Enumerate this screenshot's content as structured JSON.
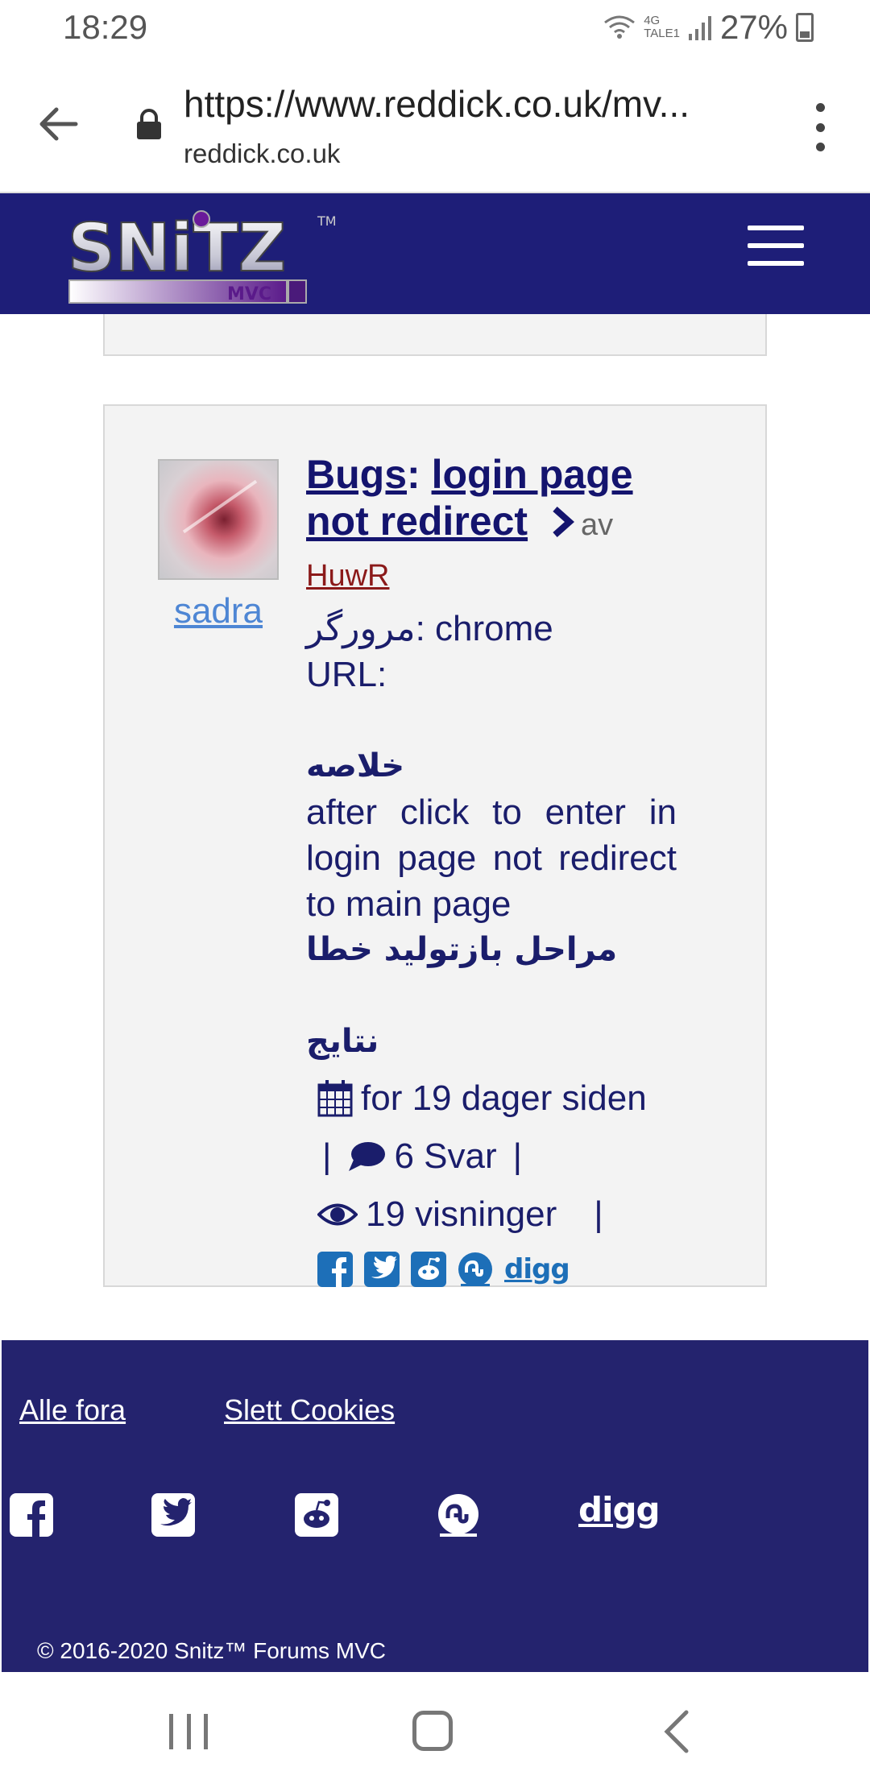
{
  "status_bar": {
    "time": "18:29",
    "network_top": "4G",
    "network_bottom": "TALE1",
    "battery": "27%"
  },
  "browser": {
    "url": "https://www.reddick.co.uk/mv...",
    "host": "reddick.co.uk"
  },
  "site": {
    "logo_text": "SNiTZ",
    "logo_sub": "MVC",
    "logo_tm": "TM"
  },
  "post": {
    "username": "sadra",
    "category": "Bugs",
    "separator": ":",
    "title": "login page not redirect",
    "by_label": "av",
    "author": "HuwR",
    "line_browser": "مرورگر: chrome",
    "line_url": "URL:",
    "summary_heading": "خلاصه",
    "summary_text": "after click to enter in login page not redirect to main page",
    "steps_heading": "مراحل بازتولید خطا",
    "results_heading": "نتایج",
    "date": "for 19 dager siden",
    "replies": "6 Svar",
    "views": "19 visninger",
    "pipe": "|",
    "share": [
      "facebook-icon",
      "twitter-icon",
      "reddit-icon",
      "stumbleupon-icon",
      "digg"
    ],
    "digg_label": "digg"
  },
  "footer": {
    "link_all_forums": "Alle fora",
    "link_delete_cookies": "Slett Cookies",
    "digg_label": "digg",
    "copyright": "© 2016-2020 Snitz™ Forums MVC"
  },
  "colors": {
    "header_bg": "#1e1e78",
    "footer_bg": "#24236e",
    "text_navy": "#1a1d6b",
    "link_blue": "#4e86d4",
    "author_red": "#8b1a1a"
  }
}
